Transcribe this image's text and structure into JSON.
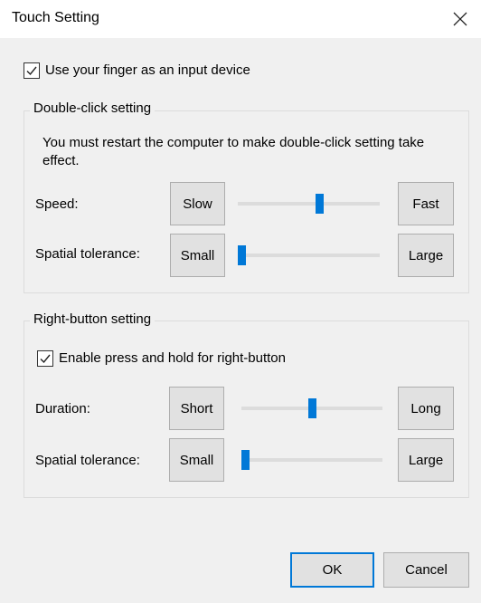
{
  "window": {
    "title": "Touch Setting"
  },
  "finger_input": {
    "label": "Use your finger as an input device",
    "checked": true
  },
  "double_click": {
    "group_title": "Double-click setting",
    "note": "You must restart the computer to make double-click setting take effect.",
    "speed": {
      "label": "Speed:",
      "min_label": "Slow",
      "max_label": "Fast",
      "value": 0.58
    },
    "tolerance": {
      "label": "Spatial tolerance:",
      "min_label": "Small",
      "max_label": "Large",
      "value": 0.0
    }
  },
  "right_button": {
    "group_title": "Right-button setting",
    "press_hold": {
      "label": "Enable press and hold for right-button",
      "checked": true
    },
    "duration": {
      "label": "Duration:",
      "min_label": "Short",
      "max_label": "Long",
      "value": 0.5
    },
    "tolerance": {
      "label": "Spatial tolerance:",
      "min_label": "Small",
      "max_label": "Large",
      "value": 0.0
    }
  },
  "footer": {
    "ok_label": "OK",
    "cancel_label": "Cancel"
  },
  "colors": {
    "accent": "#0078d7",
    "track": "#dcdcdc",
    "button_face": "#e1e1e1"
  },
  "icons": {
    "close": "close-icon",
    "check": "checkmark-icon"
  }
}
